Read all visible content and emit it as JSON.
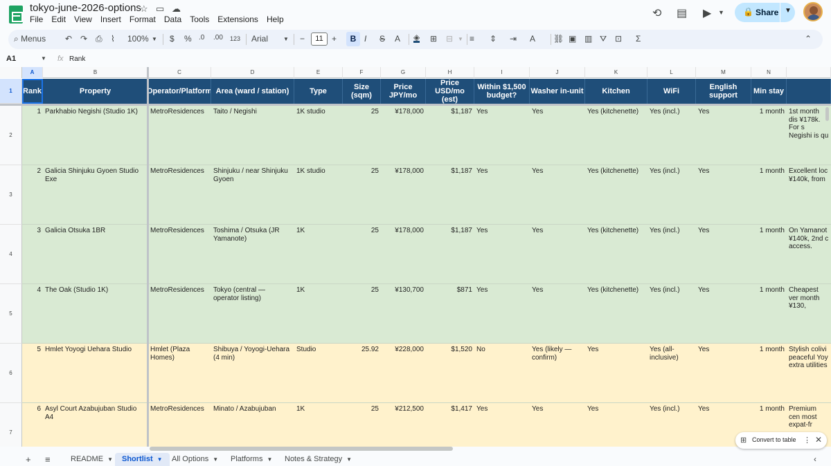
{
  "app": {
    "doc_title": "tokyo-june-2026-options",
    "menus": [
      "File",
      "Edit",
      "View",
      "Insert",
      "Format",
      "Data",
      "Tools",
      "Extensions",
      "Help"
    ],
    "share_label": "Share"
  },
  "toolbar": {
    "search_label": "Menus",
    "zoom": "100%",
    "currency": "$",
    "percent": "%",
    "dec_decrease": ".0",
    "dec_increase": ".00",
    "format_123": "123",
    "font": "Arial",
    "font_size": "11",
    "bold": "B",
    "italic": "I",
    "strike": "S",
    "text_color": "A"
  },
  "formula": {
    "cell_ref": "A1",
    "fx": "fx",
    "value": "Rank"
  },
  "columns": [
    "A",
    "B",
    "C",
    "D",
    "E",
    "F",
    "G",
    "H",
    "I",
    "J",
    "K",
    "L",
    "M",
    "N"
  ],
  "rows": [
    "1",
    "2",
    "3",
    "4",
    "5",
    "6",
    "7"
  ],
  "headers": [
    "Rank",
    "Property",
    "Operator/Platform",
    "Area (ward / station)",
    "Type",
    "Size (sqm)",
    "Price JPY/mo",
    "Price USD/mo (est)",
    "Within $1,500 budget?",
    "Washer in-unit",
    "Kitchen",
    "WiFi",
    "English support",
    "Min stay",
    ""
  ],
  "data_rows": [
    {
      "rank": "1",
      "property": "Parkhabio Negishi (Studio 1K)",
      "operator": "MetroResidences",
      "area": "Taito / Negishi",
      "type": "1K studio",
      "size": "25",
      "jpy": "¥178,000",
      "usd": "$1,187",
      "budget": "Yes",
      "washer": "Yes",
      "kitchen": "Yes (kitchenette)",
      "wifi": "Yes (incl.)",
      "english": "Yes",
      "minstay": "1 month",
      "notes": "1st month dis ¥178k. For s Negishi is qu",
      "color": "green"
    },
    {
      "rank": "2",
      "property": "Galicia Shinjuku Gyoen Studio Exe",
      "operator": "MetroResidences",
      "area": "Shinjuku / near Shinjuku Gyoen",
      "type": "1K studio",
      "size": "25",
      "jpy": "¥178,000",
      "usd": "$1,187",
      "budget": "Yes",
      "washer": "Yes",
      "kitchen": "Yes (kitchenette)",
      "wifi": "Yes (incl.)",
      "english": "Yes",
      "minstay": "1 month",
      "notes": "Excellent loc ¥140k, from",
      "color": "green"
    },
    {
      "rank": "3",
      "property": "Galicia Otsuka 1BR",
      "operator": "MetroResidences",
      "area": "Toshima / Otsuka (JR Yamanote)",
      "type": "1K",
      "size": "25",
      "jpy": "¥178,000",
      "usd": "$1,187",
      "budget": "Yes",
      "washer": "Yes",
      "kitchen": "Yes (kitchenette)",
      "wifi": "Yes (incl.)",
      "english": "Yes",
      "minstay": "1 month",
      "notes": "On Yamanot ¥140k, 2nd c access.",
      "color": "green"
    },
    {
      "rank": "4",
      "property": "The Oak (Studio 1K)",
      "operator": "MetroResidences",
      "area": "Tokyo (central — operator listing)",
      "type": "1K",
      "size": "25",
      "jpy": "¥130,700",
      "usd": "$871",
      "budget": "Yes",
      "washer": "Yes",
      "kitchen": "Yes (kitchenette)",
      "wifi": "Yes (incl.)",
      "english": "Yes",
      "minstay": "1 month",
      "notes": "Cheapest ver month ¥130,",
      "color": "green"
    },
    {
      "rank": "5",
      "property": "Hmlet Yoyogi Uehara Studio",
      "operator": "Hmlet (Plaza Homes)",
      "area": "Shibuya / Yoyogi-Uehara (4 min)",
      "type": "Studio",
      "size": "25.92",
      "jpy": "¥228,000",
      "usd": "$1,520",
      "budget": "No",
      "washer": "Yes (likely — confirm)",
      "kitchen": "Yes",
      "wifi": "Yes (all-inclusive)",
      "english": "Yes",
      "minstay": "1 month",
      "notes": "Stylish colivi peaceful Yoy extra utilities",
      "color": "yellow"
    },
    {
      "rank": "6",
      "property": "Asyl Court Azabujuban Studio A4",
      "operator": "MetroResidences",
      "area": "Minato / Azabujuban",
      "type": "1K",
      "size": "25",
      "jpy": "¥212,500",
      "usd": "$1,417",
      "budget": "Yes",
      "washer": "Yes",
      "kitchen": "Yes",
      "wifi": "Yes (incl.)",
      "english": "Yes",
      "minstay": "1 month",
      "notes": "Premium cen most expat-fr",
      "color": "yellow"
    }
  ],
  "sheets": [
    {
      "name": "README",
      "active": false
    },
    {
      "name": "Shortlist",
      "active": true
    },
    {
      "name": "All Options",
      "active": false
    },
    {
      "name": "Platforms",
      "active": false
    },
    {
      "name": "Notes & Strategy",
      "active": false
    }
  ],
  "convert_chip": {
    "label": "Convert to table"
  },
  "colors": {
    "header_bg": "#1f4e79",
    "green_row": "#d9ead3",
    "yellow_row": "#fff2cc",
    "accent": "#0b57d0",
    "share_bg": "#c2e7ff"
  }
}
